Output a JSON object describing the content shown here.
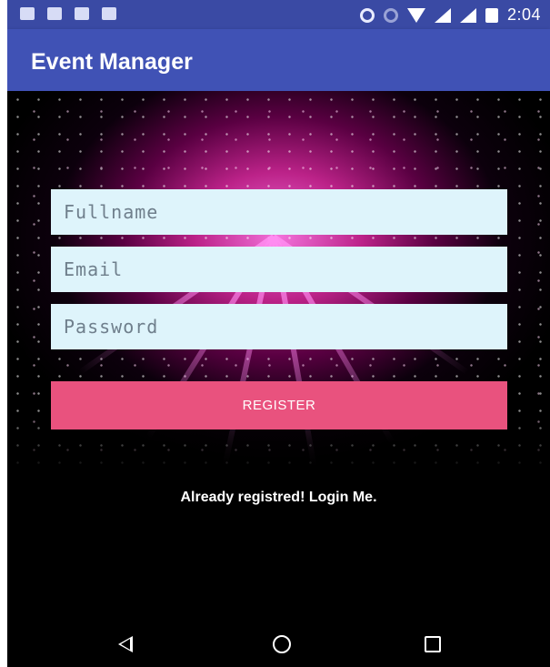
{
  "status_bar": {
    "time": "2:04",
    "icons_left": [
      "image-icon",
      "photo-icon",
      "gallery-icon",
      "android-icon"
    ],
    "icons_right": [
      "sync-icon",
      "alarm-icon",
      "wifi-icon",
      "signal-icon",
      "signal-icon",
      "battery-icon"
    ]
  },
  "app_bar": {
    "title": "Event Manager",
    "color": "#4052b5"
  },
  "form": {
    "fullname_placeholder": "Fullname",
    "email_placeholder": "Email",
    "password_placeholder": "Password",
    "register_label": "REGISTER",
    "register_color": "#e9527e",
    "field_color": "#def4fb"
  },
  "login_link": "Already registred! Login Me.",
  "nav_bar": {
    "back": "back-icon",
    "home": "home-icon",
    "recents": "recents-icon"
  }
}
